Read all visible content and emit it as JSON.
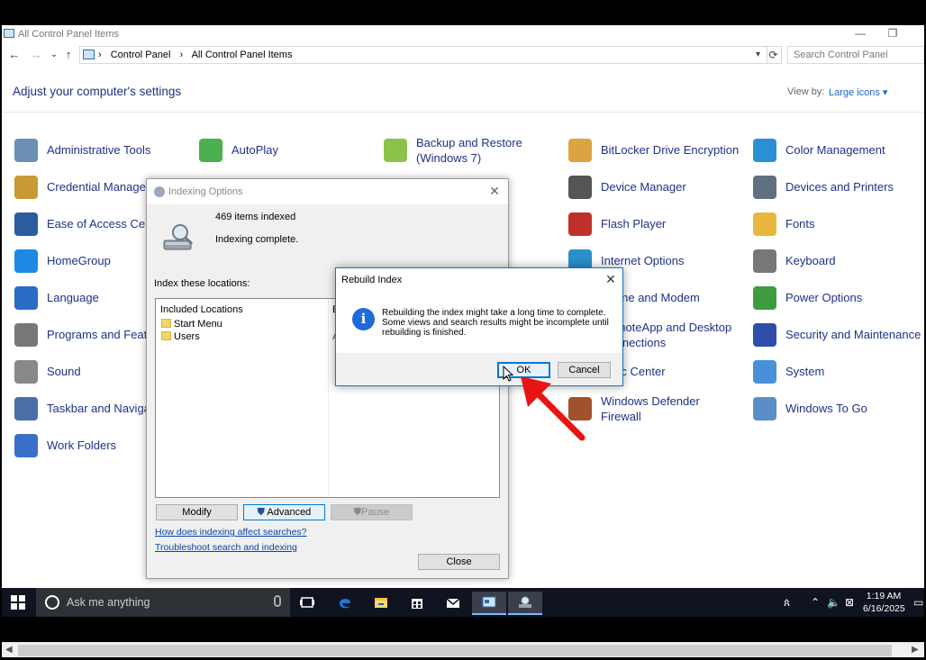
{
  "window": {
    "title": "All Control Panel Items",
    "minimize": "—",
    "restore": "❐"
  },
  "nav": {
    "back": "←",
    "forward": "→",
    "recent": "⌄",
    "up": "↑",
    "refresh": "⟳"
  },
  "address": {
    "crumbs": [
      "Control Panel",
      "All Control Panel Items"
    ],
    "separator": "›"
  },
  "search": {
    "placeholder": "Search Control Panel"
  },
  "header": {
    "title": "Adjust your computer's settings",
    "view_by_label": "View by:",
    "view_by_value": "Large icons ▾"
  },
  "items": [
    {
      "label": "Administrative Tools",
      "icon": "admin-tools-icon"
    },
    {
      "label": "AutoPlay",
      "icon": "autoplay-icon"
    },
    {
      "label": "Backup and Restore\n(Windows 7)",
      "icon": "backup-icon"
    },
    {
      "label": "BitLocker Drive Encryption",
      "icon": "bitlocker-icon"
    },
    {
      "label": "Color Management",
      "icon": "color-management-icon"
    },
    {
      "label": "Credential Manager",
      "icon": "credential-icon"
    },
    {
      "label": "Device Manager",
      "icon": "device-manager-icon"
    },
    {
      "label": "Devices and Printers",
      "icon": "printer-icon"
    },
    {
      "label": "Ease of Access Center",
      "icon": "ease-of-access-icon"
    },
    {
      "label": "Flash Player",
      "icon": "flash-icon"
    },
    {
      "label": "Fonts",
      "icon": "fonts-icon"
    },
    {
      "label": "HomeGroup",
      "icon": "homegroup-icon"
    },
    {
      "label": "Internet Options",
      "icon": "internet-options-icon"
    },
    {
      "label": "Keyboard",
      "icon": "keyboard-icon"
    },
    {
      "label": "Language",
      "icon": "language-icon"
    },
    {
      "label": "Phone and Modem",
      "icon": "phone-icon"
    },
    {
      "label": "Power Options",
      "icon": "power-icon"
    },
    {
      "label": "Programs and Features",
      "icon": "programs-icon"
    },
    {
      "label": "RemoteApp and Desktop\nConnections",
      "icon": "remoteapp-icon"
    },
    {
      "label": "Security and Maintenance",
      "icon": "flag-icon"
    },
    {
      "label": "Sound",
      "icon": "sound-icon"
    },
    {
      "label": "Sync Center",
      "icon": "sync-icon"
    },
    {
      "label": "System",
      "icon": "system-icon"
    },
    {
      "label": "Taskbar and Navigation",
      "icon": "taskbar-icon"
    },
    {
      "label": "Windows Defender\nFirewall",
      "icon": "firewall-icon"
    },
    {
      "label": "Windows To Go",
      "icon": "windows-to-go-icon"
    },
    {
      "label": "Work Folders",
      "icon": "work-folders-icon"
    }
  ],
  "indexing": {
    "title": "Indexing Options",
    "count": "469 items indexed",
    "status": "Indexing complete.",
    "locations_label": "Index these locations:",
    "col_included": "Included Locations",
    "col_excluded": "E",
    "rows": [
      "Start Menu",
      "Users"
    ],
    "row2_excluded": "A",
    "modify": "Modify",
    "advanced": "Advanced",
    "pause": "Pause",
    "link_affect": "How does indexing affect searches?",
    "link_troubleshoot": "Troubleshoot search and indexing",
    "close": "Close"
  },
  "rebuild": {
    "title": "Rebuild Index",
    "message": "Rebuilding the index might take a long time to complete. Some views and search results might be incomplete until rebuilding is finished.",
    "ok": "OK",
    "cancel": "Cancel",
    "info_glyph": "i"
  },
  "taskbar": {
    "search_placeholder": "Ask me anything",
    "time": "1:19 AM",
    "date": "6/16/2025"
  },
  "colors": {
    "link": "#1e3287",
    "accent": "#0078d7",
    "taskbar": "#101420",
    "arrow": "#e81414"
  }
}
